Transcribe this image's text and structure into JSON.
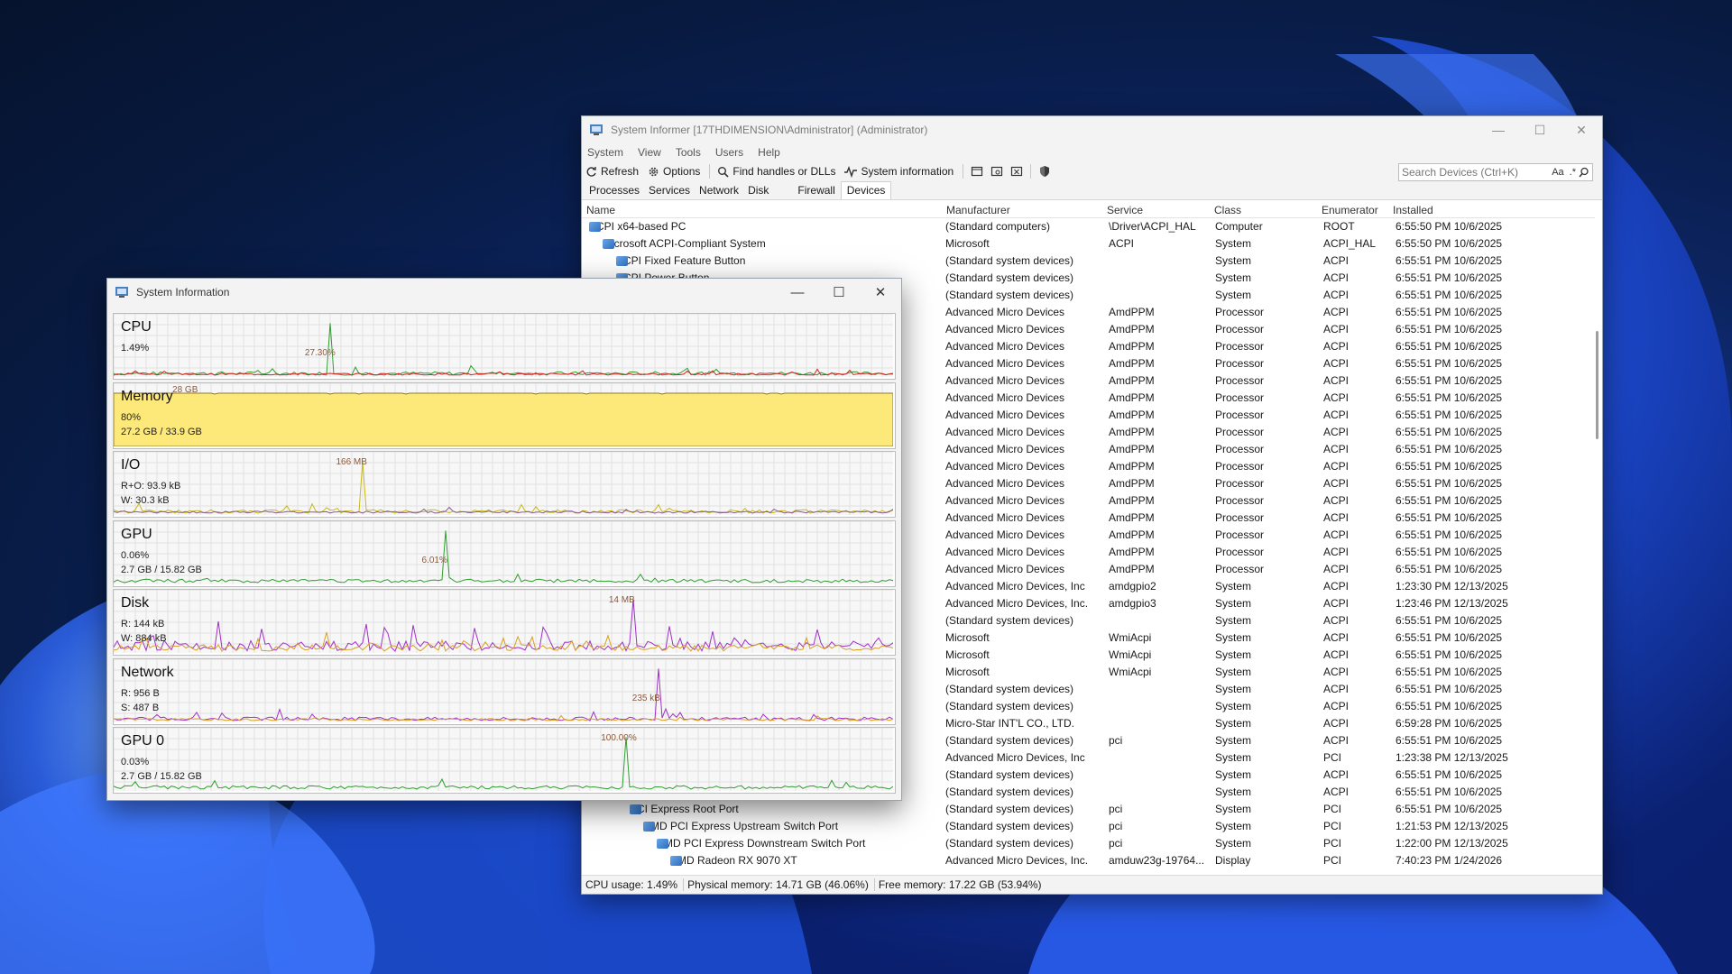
{
  "desktop": {
    "wallpaper": "windows-11-bloom-blue"
  },
  "main_window": {
    "title": "System Informer [17THDIMENSION\\Administrator] (Administrator)",
    "menu": [
      "System",
      "View",
      "Tools",
      "Users",
      "Help"
    ],
    "toolbar": {
      "refresh": "Refresh",
      "options": "Options",
      "find_handles": "Find handles or DLLs",
      "system_information": "System information"
    },
    "search": {
      "placeholder": "Search Devices (Ctrl+K)",
      "case_label": "Aa",
      "regex_label": ".*"
    },
    "tabs": [
      "Processes",
      "Services",
      "Network",
      "Disk",
      "Firewall",
      "Devices"
    ],
    "active_tab": "Devices",
    "columns": [
      "Name",
      "Manufacturer",
      "Service",
      "Class",
      "Enumerator",
      "Installed"
    ],
    "rows": [
      {
        "name": "ACPI x64-based PC",
        "indent": 0,
        "chevron": "v",
        "manufacturer": "(Standard computers)",
        "service": "\\Driver\\ACPI_HAL",
        "class": "Computer",
        "enumerator": "ROOT",
        "installed": "6:55:50 PM 10/6/2025"
      },
      {
        "name": "Microsoft ACPI-Compliant System",
        "indent": 1,
        "chevron": "v",
        "manufacturer": "Microsoft",
        "service": "ACPI",
        "class": "System",
        "enumerator": "ACPI_HAL",
        "installed": "6:55:50 PM 10/6/2025"
      },
      {
        "name": "ACPI Fixed Feature Button",
        "indent": 2,
        "chevron": "",
        "manufacturer": "(Standard system devices)",
        "service": "",
        "class": "System",
        "enumerator": "ACPI",
        "installed": "6:55:51 PM 10/6/2025"
      },
      {
        "name": "ACPI Power Button",
        "indent": 2,
        "chevron": "",
        "manufacturer": "(Standard system devices)",
        "service": "",
        "class": "System",
        "enumerator": "ACPI",
        "installed": "6:55:51 PM 10/6/2025"
      },
      {
        "name": "",
        "indent": 2,
        "chevron": "",
        "manufacturer": "(Standard system devices)",
        "service": "",
        "class": "System",
        "enumerator": "ACPI",
        "installed": "6:55:51 PM 10/6/2025"
      },
      {
        "name": "",
        "indent": 2,
        "chevron": "",
        "manufacturer": "Advanced Micro Devices",
        "service": "AmdPPM",
        "class": "Processor",
        "enumerator": "ACPI",
        "installed": "6:55:51 PM 10/6/2025"
      },
      {
        "name": "",
        "indent": 2,
        "chevron": "",
        "manufacturer": "Advanced Micro Devices",
        "service": "AmdPPM",
        "class": "Processor",
        "enumerator": "ACPI",
        "installed": "6:55:51 PM 10/6/2025"
      },
      {
        "name": "",
        "indent": 2,
        "chevron": "",
        "manufacturer": "Advanced Micro Devices",
        "service": "AmdPPM",
        "class": "Processor",
        "enumerator": "ACPI",
        "installed": "6:55:51 PM 10/6/2025"
      },
      {
        "name": "",
        "indent": 2,
        "chevron": "",
        "manufacturer": "Advanced Micro Devices",
        "service": "AmdPPM",
        "class": "Processor",
        "enumerator": "ACPI",
        "installed": "6:55:51 PM 10/6/2025"
      },
      {
        "name": "",
        "indent": 2,
        "chevron": "",
        "manufacturer": "Advanced Micro Devices",
        "service": "AmdPPM",
        "class": "Processor",
        "enumerator": "ACPI",
        "installed": "6:55:51 PM 10/6/2025"
      },
      {
        "name": "",
        "indent": 2,
        "chevron": "",
        "manufacturer": "Advanced Micro Devices",
        "service": "AmdPPM",
        "class": "Processor",
        "enumerator": "ACPI",
        "installed": "6:55:51 PM 10/6/2025"
      },
      {
        "name": "",
        "indent": 2,
        "chevron": "",
        "manufacturer": "Advanced Micro Devices",
        "service": "AmdPPM",
        "class": "Processor",
        "enumerator": "ACPI",
        "installed": "6:55:51 PM 10/6/2025"
      },
      {
        "name": "",
        "indent": 2,
        "chevron": "",
        "manufacturer": "Advanced Micro Devices",
        "service": "AmdPPM",
        "class": "Processor",
        "enumerator": "ACPI",
        "installed": "6:55:51 PM 10/6/2025"
      },
      {
        "name": "",
        "indent": 2,
        "chevron": "",
        "manufacturer": "Advanced Micro Devices",
        "service": "AmdPPM",
        "class": "Processor",
        "enumerator": "ACPI",
        "installed": "6:55:51 PM 10/6/2025"
      },
      {
        "name": "",
        "indent": 2,
        "chevron": "",
        "manufacturer": "Advanced Micro Devices",
        "service": "AmdPPM",
        "class": "Processor",
        "enumerator": "ACPI",
        "installed": "6:55:51 PM 10/6/2025"
      },
      {
        "name": "",
        "indent": 2,
        "chevron": "",
        "manufacturer": "Advanced Micro Devices",
        "service": "AmdPPM",
        "class": "Processor",
        "enumerator": "ACPI",
        "installed": "6:55:51 PM 10/6/2025"
      },
      {
        "name": "",
        "indent": 2,
        "chevron": "",
        "manufacturer": "Advanced Micro Devices",
        "service": "AmdPPM",
        "class": "Processor",
        "enumerator": "ACPI",
        "installed": "6:55:51 PM 10/6/2025"
      },
      {
        "name": "",
        "indent": 2,
        "chevron": "",
        "manufacturer": "Advanced Micro Devices",
        "service": "AmdPPM",
        "class": "Processor",
        "enumerator": "ACPI",
        "installed": "6:55:51 PM 10/6/2025"
      },
      {
        "name": "",
        "indent": 2,
        "chevron": "",
        "manufacturer": "Advanced Micro Devices",
        "service": "AmdPPM",
        "class": "Processor",
        "enumerator": "ACPI",
        "installed": "6:55:51 PM 10/6/2025"
      },
      {
        "name": "",
        "indent": 2,
        "chevron": "",
        "manufacturer": "Advanced Micro Devices",
        "service": "AmdPPM",
        "class": "Processor",
        "enumerator": "ACPI",
        "installed": "6:55:51 PM 10/6/2025"
      },
      {
        "name": "",
        "indent": 2,
        "chevron": "",
        "manufacturer": "Advanced Micro Devices",
        "service": "AmdPPM",
        "class": "Processor",
        "enumerator": "ACPI",
        "installed": "6:55:51 PM 10/6/2025"
      },
      {
        "name": "",
        "indent": 2,
        "chevron": "",
        "manufacturer": "Advanced Micro Devices, Inc",
        "service": "amdgpio2",
        "class": "System",
        "enumerator": "ACPI",
        "installed": "1:23:30 PM 12/13/2025"
      },
      {
        "name": "",
        "indent": 2,
        "chevron": "",
        "manufacturer": "Advanced Micro Devices, Inc.",
        "service": "amdgpio3",
        "class": "System",
        "enumerator": "ACPI",
        "installed": "1:23:46 PM 12/13/2025"
      },
      {
        "name": "",
        "indent": 2,
        "chevron": "",
        "manufacturer": "(Standard system devices)",
        "service": "",
        "class": "System",
        "enumerator": "ACPI",
        "installed": "6:55:51 PM 10/6/2025"
      },
      {
        "name": "",
        "indent": 2,
        "chevron": "",
        "manufacturer": "Microsoft",
        "service": "WmiAcpi",
        "class": "System",
        "enumerator": "ACPI",
        "installed": "6:55:51 PM 10/6/2025"
      },
      {
        "name": "",
        "indent": 2,
        "chevron": "",
        "manufacturer": "Microsoft",
        "service": "WmiAcpi",
        "class": "System",
        "enumerator": "ACPI",
        "installed": "6:55:51 PM 10/6/2025"
      },
      {
        "name": "",
        "indent": 2,
        "chevron": "",
        "manufacturer": "Microsoft",
        "service": "WmiAcpi",
        "class": "System",
        "enumerator": "ACPI",
        "installed": "6:55:51 PM 10/6/2025"
      },
      {
        "name": "",
        "indent": 2,
        "chevron": "",
        "manufacturer": "(Standard system devices)",
        "service": "",
        "class": "System",
        "enumerator": "ACPI",
        "installed": "6:55:51 PM 10/6/2025"
      },
      {
        "name": "",
        "indent": 2,
        "chevron": "",
        "manufacturer": "(Standard system devices)",
        "service": "",
        "class": "System",
        "enumerator": "ACPI",
        "installed": "6:55:51 PM 10/6/2025"
      },
      {
        "name": "",
        "indent": 2,
        "chevron": "",
        "manufacturer": "Micro-Star INT'L CO., LTD.",
        "service": "",
        "class": "System",
        "enumerator": "ACPI",
        "installed": "6:59:28 PM 10/6/2025"
      },
      {
        "name": "",
        "indent": 2,
        "chevron": "",
        "manufacturer": "(Standard system devices)",
        "service": "pci",
        "class": "System",
        "enumerator": "ACPI",
        "installed": "6:55:51 PM 10/6/2025"
      },
      {
        "name": "",
        "indent": 2,
        "chevron": "",
        "manufacturer": "Advanced Micro Devices, Inc",
        "service": "",
        "class": "System",
        "enumerator": "PCI",
        "installed": "1:23:38 PM 12/13/2025"
      },
      {
        "name": "",
        "indent": 2,
        "chevron": "",
        "manufacturer": "(Standard system devices)",
        "service": "",
        "class": "System",
        "enumerator": "ACPI",
        "installed": "6:55:51 PM 10/6/2025"
      },
      {
        "name": "",
        "indent": 2,
        "chevron": "",
        "manufacturer": "(Standard system devices)",
        "service": "",
        "class": "System",
        "enumerator": "ACPI",
        "installed": "6:55:51 PM 10/6/2025"
      },
      {
        "name": "PCI Express Root Port",
        "indent": 3,
        "chevron": "v",
        "manufacturer": "(Standard system devices)",
        "service": "pci",
        "class": "System",
        "enumerator": "PCI",
        "installed": "6:55:51 PM 10/6/2025"
      },
      {
        "name": "AMD PCI Express Upstream Switch Port",
        "indent": 4,
        "chevron": "v",
        "manufacturer": "(Standard system devices)",
        "service": "pci",
        "class": "System",
        "enumerator": "PCI",
        "installed": "1:21:53 PM 12/13/2025"
      },
      {
        "name": "AMD PCI Express Downstream Switch Port",
        "indent": 5,
        "chevron": "v",
        "manufacturer": "(Standard system devices)",
        "service": "pci",
        "class": "System",
        "enumerator": "PCI",
        "installed": "1:22:00 PM 12/13/2025"
      },
      {
        "name": "AMD Radeon RX 9070 XT",
        "indent": 6,
        "chevron": "v",
        "manufacturer": "Advanced Micro Devices, Inc.",
        "service": "amduw23g-19764...",
        "class": "Display",
        "enumerator": "PCI",
        "installed": "7:40:23 PM 1/24/2026"
      }
    ],
    "status": {
      "cpu": "CPU usage: 1.49%",
      "physical": "Physical memory: 14.71 GB (46.06%)",
      "free": "Free memory: 17.22 GB (53.94%)"
    }
  },
  "sysinfo_window": {
    "title": "System Information",
    "panels": [
      {
        "key": "cpu",
        "name": "CPU",
        "line1": "1.49%",
        "line2": "",
        "peak": "27.30%",
        "colors": [
          "#2f9e2f",
          "#d62020"
        ],
        "fill": "#ffffff"
      },
      {
        "key": "memory",
        "name": "Memory",
        "line1": "80%",
        "line2": "27.2 GB / 33.9 GB",
        "peak": "28 GB",
        "colors": [
          "#8a7a30"
        ],
        "fill": "#fde97a"
      },
      {
        "key": "io",
        "name": "I/O",
        "line1": "R+O: 93.9 kB",
        "line2": "W: 30.3 kB",
        "peak": "166 MB",
        "colors": [
          "#c8b818",
          "#8a5a8a"
        ],
        "fill": "#ffffff"
      },
      {
        "key": "gpu",
        "name": "GPU",
        "line1": "0.06%",
        "line2": "2.7 GB / 15.82 GB",
        "peak": "6.01%",
        "colors": [
          "#2f9e2f"
        ],
        "fill": "#ffffff"
      },
      {
        "key": "disk",
        "name": "Disk",
        "line1": "R: 144 kB",
        "line2": "W: 884 kB",
        "peak": "14 MB",
        "colors": [
          "#a030c8",
          "#d8a020"
        ],
        "fill": "#ffffff"
      },
      {
        "key": "network",
        "name": "Network",
        "line1": "R: 956 B",
        "line2": "S: 487 B",
        "peak": "235 kB",
        "colors": [
          "#a030c8",
          "#d8a020"
        ],
        "fill": "#ffffff"
      },
      {
        "key": "gpu0",
        "name": "GPU 0",
        "line1": "0.03%",
        "line2": "2.7 GB / 15.82 GB",
        "peak": "100.00%",
        "colors": [
          "#2f9e2f"
        ],
        "fill": "#ffffff"
      }
    ]
  }
}
